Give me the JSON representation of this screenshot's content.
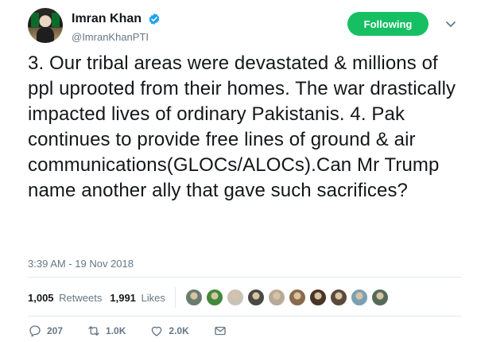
{
  "author": {
    "display_name": "Imran Khan",
    "handle": "@ImranKhanPTI",
    "verified_icon": "verified-badge-icon",
    "avatar_icon": "avatar"
  },
  "follow_button": {
    "label": "Following",
    "color": "#17bf63"
  },
  "menu_icon": "chevron-down-icon",
  "tweet": {
    "text": "3. Our tribal areas were devastated & millions of ppl uprooted from their homes. The war drastically impacted lives of ordinary Pakistanis. 4. Pak continues to provide free lines of ground & air communications(GLOCs/ALOCs).Can Mr Trump name another ally that gave such sacrifices?",
    "timestamp": "3:39 AM - 19 Nov 2018"
  },
  "stats": {
    "retweets_count": "1,005",
    "retweets_label": "Retweets",
    "likes_count": "1,991",
    "likes_label": "Likes",
    "liker_avatar_colors": [
      "#6b7c6e",
      "#3f8a3a",
      "#c9c2b6",
      "#4a4a44",
      "#b8aa98",
      "#8a6a4a",
      "#4a3426",
      "#5a4a3a",
      "#7aa0b4",
      "#556b5a"
    ]
  },
  "actions": {
    "reply": {
      "icon": "reply-icon",
      "count": "207"
    },
    "retweet": {
      "icon": "retweet-icon",
      "count": "1.0K"
    },
    "like": {
      "icon": "heart-icon",
      "count": "2.0K"
    },
    "message": {
      "icon": "direct-message-icon"
    }
  },
  "colors": {
    "verified": "#1da1f2",
    "text": "#14171a",
    "muted": "#657786",
    "divider": "#e1e8ed"
  }
}
